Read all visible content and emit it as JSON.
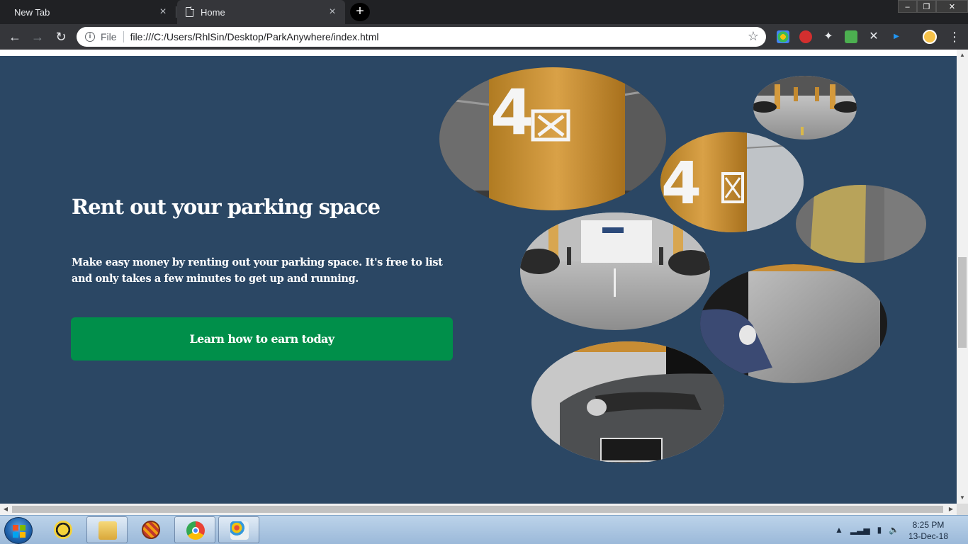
{
  "tabs": [
    {
      "label": "New Tab"
    },
    {
      "label": "Home"
    }
  ],
  "tab_close_glyph": "×",
  "new_tab_glyph": "+",
  "window_controls": {
    "minimize": "–",
    "maximize": "❐",
    "close": "✕"
  },
  "toolbar": {
    "back": "←",
    "forward": "→",
    "reload": "↻",
    "scheme": "File",
    "url": "file:///C:/Users/RhlSin/Desktop/ParkAnywhere/index.html",
    "bookmark_icon": "star-icon",
    "menu_glyph": "⋮"
  },
  "page": {
    "background": "#2b4764",
    "headline": "Rent out your parking space",
    "subtext": "Make easy money by renting out your parking space. It's free to list and only takes a few minutes to get up and running.",
    "cta_label": "Learn how to earn today",
    "cta_color": "#008f4a"
  },
  "taskbar": {
    "time": "8:25 PM",
    "date": "13-Dec-18",
    "tray_expand": "▲"
  }
}
